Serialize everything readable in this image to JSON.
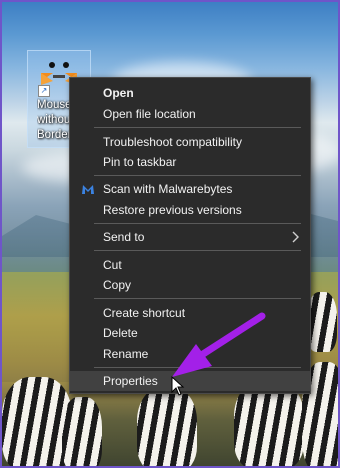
{
  "desktop": {
    "icon_label": "Mouse without Borders",
    "icon_name": "mouse-without-borders-icon"
  },
  "context_menu": {
    "items": [
      {
        "label": "Open",
        "bold": true
      },
      {
        "label": "Open file location"
      },
      {
        "label": "Troubleshoot compatibility"
      },
      {
        "label": "Pin to taskbar"
      },
      {
        "label": "Scan with Malwarebytes",
        "icon": "malwarebytes-icon"
      },
      {
        "label": "Restore previous versions"
      },
      {
        "label": "Send to",
        "submenu": true
      },
      {
        "label": "Cut"
      },
      {
        "label": "Copy"
      },
      {
        "label": "Create shortcut"
      },
      {
        "label": "Delete"
      },
      {
        "label": "Rename"
      },
      {
        "label": "Properties",
        "highlighted": true
      }
    ]
  },
  "annotation": {
    "arrow_color": "#a320e8"
  },
  "colors": {
    "menu_bg": "#2b2b2b",
    "menu_text": "#f2f2f2",
    "frame": "#6f55c9"
  }
}
